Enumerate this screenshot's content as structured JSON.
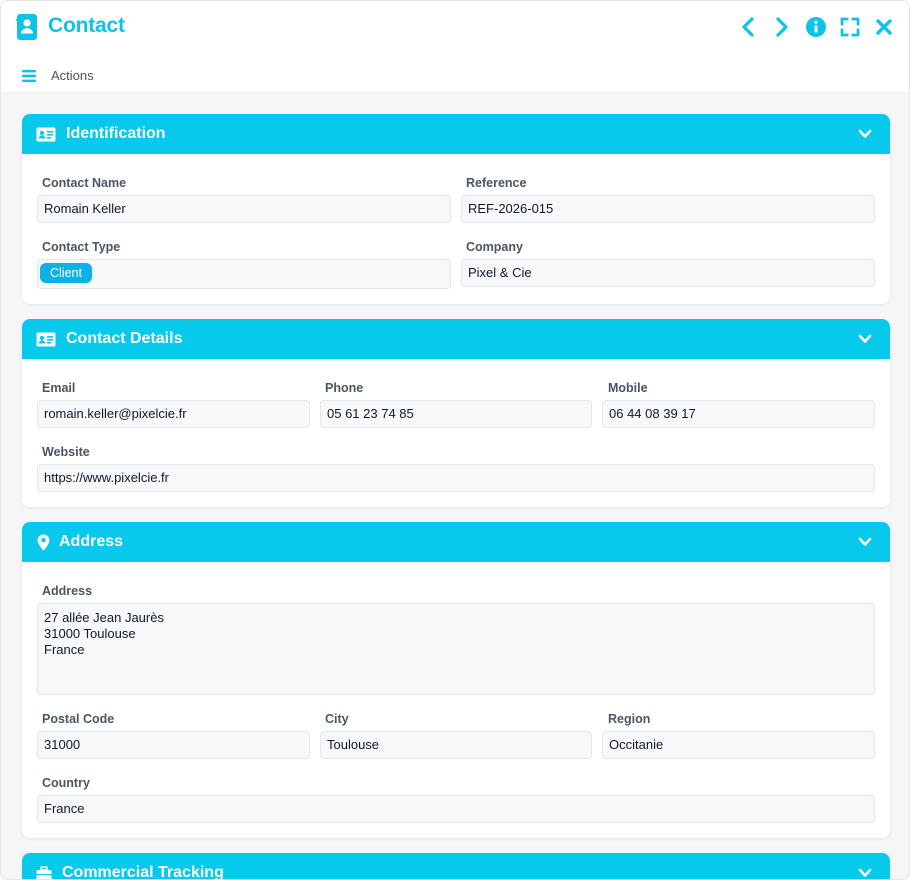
{
  "window": {
    "title": "Contact",
    "icons": [
      "contact-book-icon",
      "chevron-left-icon",
      "chevron-right-icon",
      "info-icon",
      "fullscreen-icon",
      "close-icon"
    ],
    "accent_color": "#06c9ec"
  },
  "toolbar": {
    "actions_label": "Actions",
    "icon": "menu-icon"
  },
  "identification": {
    "title": "Identification",
    "icon": "id-card-icon",
    "contact_name_label": "Contact Name",
    "contact_name": "Romain Keller",
    "reference_label": "Reference",
    "reference": "REF-2026-015",
    "contact_type_label": "Contact Type",
    "contact_type": "Client",
    "company_label": "Company",
    "company": "Pixel & Cie"
  },
  "details": {
    "title": "Contact Details",
    "icon": "id-card-icon",
    "email_label": "Email",
    "email": "romain.keller@pixelcie.fr",
    "phone_label": "Phone",
    "phone": "05 61 23 74 85",
    "mobile_label": "Mobile",
    "mobile": "06 44 08 39 17",
    "website_label": "Website",
    "website": "https://www.pixelcie.fr"
  },
  "address": {
    "title": "Address",
    "icon": "map-pin-icon",
    "address_label": "Address",
    "address": "27 allée Jean Jaurès\n31000 Toulouse\nFrance",
    "postal_code_label": "Postal Code",
    "postal_code": "31000",
    "city_label": "City",
    "city": "Toulouse",
    "region_label": "Region",
    "region": "Occitanie",
    "country_label": "Country",
    "country": "France"
  },
  "commercial": {
    "title": "Commercial Tracking",
    "icon": "briefcase-icon"
  }
}
